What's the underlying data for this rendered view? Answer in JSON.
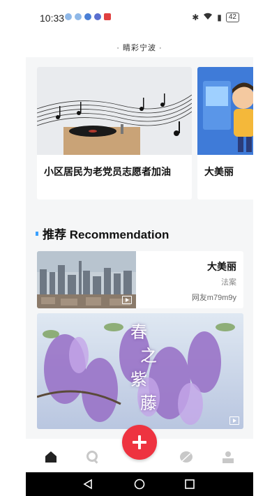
{
  "status_bar": {
    "time": "10:33",
    "battery": "42"
  },
  "app": {
    "title": "· 睛彩宁波 ·"
  },
  "carousel": {
    "cards": [
      {
        "title": "小区居民为老党员志愿者加油",
        "image": "music-notes-gramophone"
      },
      {
        "title": "大美丽",
        "image": "cartoon-boy-3d"
      }
    ]
  },
  "recommendation": {
    "section_title": "推荐 Recommendation",
    "items": [
      {
        "title": "大美丽",
        "category": "法案",
        "author": "网友m79m9y",
        "image": "city-skyline",
        "type": "video"
      },
      {
        "image": "wisteria-flowers",
        "poem": [
          "春",
          "之",
          "紫",
          "藤"
        ],
        "type": "video"
      }
    ]
  },
  "tabbar": {
    "tabs": [
      "home",
      "search",
      "add",
      "discover",
      "profile"
    ]
  },
  "colors": {
    "accent": "#3aa0ff",
    "fab": "#ee3340"
  }
}
